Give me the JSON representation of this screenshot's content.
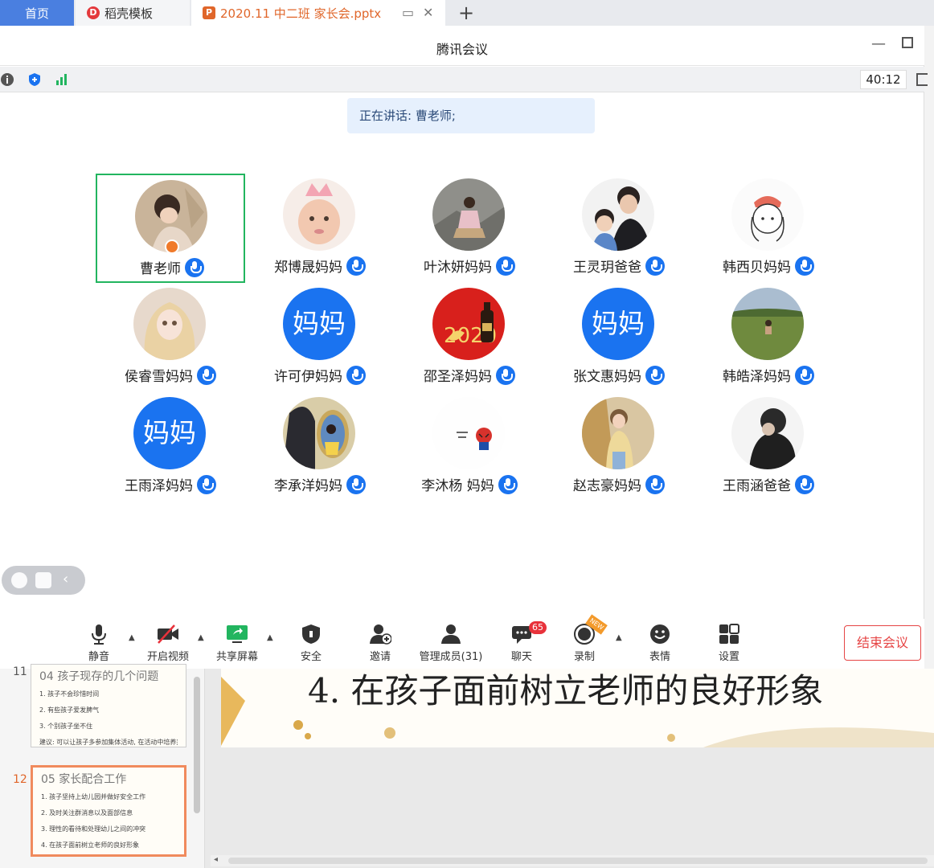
{
  "tabs": [
    {
      "label": "首页"
    },
    {
      "label": "稻壳模板"
    },
    {
      "label": "2020.11  中二班  家长会.pptx"
    }
  ],
  "window": {
    "title": "腾讯会议"
  },
  "status": {
    "timer": "40:12"
  },
  "speaking": "正在讲话: 曹老师;",
  "participants": [
    {
      "name": "曹老师"
    },
    {
      "name": "郑博晟妈妈"
    },
    {
      "name": "叶沐妍妈妈"
    },
    {
      "name": "王灵玥爸爸"
    },
    {
      "name": "韩西贝妈妈"
    },
    {
      "name": "侯睿雪妈妈"
    },
    {
      "name": "许可伊妈妈",
      "avatar_text": "妈妈"
    },
    {
      "name": "邵圣泽妈妈"
    },
    {
      "name": "张文惠妈妈",
      "avatar_text": "妈妈"
    },
    {
      "name": "韩皓泽妈妈"
    },
    {
      "name": "王雨泽妈妈",
      "avatar_text": "妈妈"
    },
    {
      "name": "李承洋妈妈"
    },
    {
      "name": "李沐杨 妈妈"
    },
    {
      "name": "赵志豪妈妈"
    },
    {
      "name": "王雨涵爸爸"
    }
  ],
  "toolbar": {
    "mute": "静音",
    "video": "开启视频",
    "share": "共享屏幕",
    "security": "安全",
    "invite": "邀请",
    "members": "管理成员(31)",
    "chat": "聊天",
    "chat_badge": "65",
    "record": "录制",
    "record_tag": "NEW",
    "reactions": "表情",
    "settings": "设置",
    "end": "结束会议"
  },
  "ppt": {
    "slides": [
      {
        "num": "11",
        "title": "04  孩子现存的几个问题",
        "lines": [
          "1. 孩子不会珍惜时间",
          "2. 有些孩子爱发脾气",
          "3. 个别孩子坐不住",
          "建议: 可以让孩子多参加集体活动, 在活动中培养兴趣等..."
        ]
      },
      {
        "num": "12",
        "title": "05     家长配合工作",
        "lines": [
          "1. 孩子坚持上幼儿园并做好安全工作",
          "2. 及时关注群消息以及面部信息",
          "3. 理性的看待和处理幼儿之间的冲突",
          "4. 在孩子面前树立老师的良好形象"
        ]
      }
    ],
    "main_text": "4. 在孩子面前树立老师的良好形象"
  }
}
